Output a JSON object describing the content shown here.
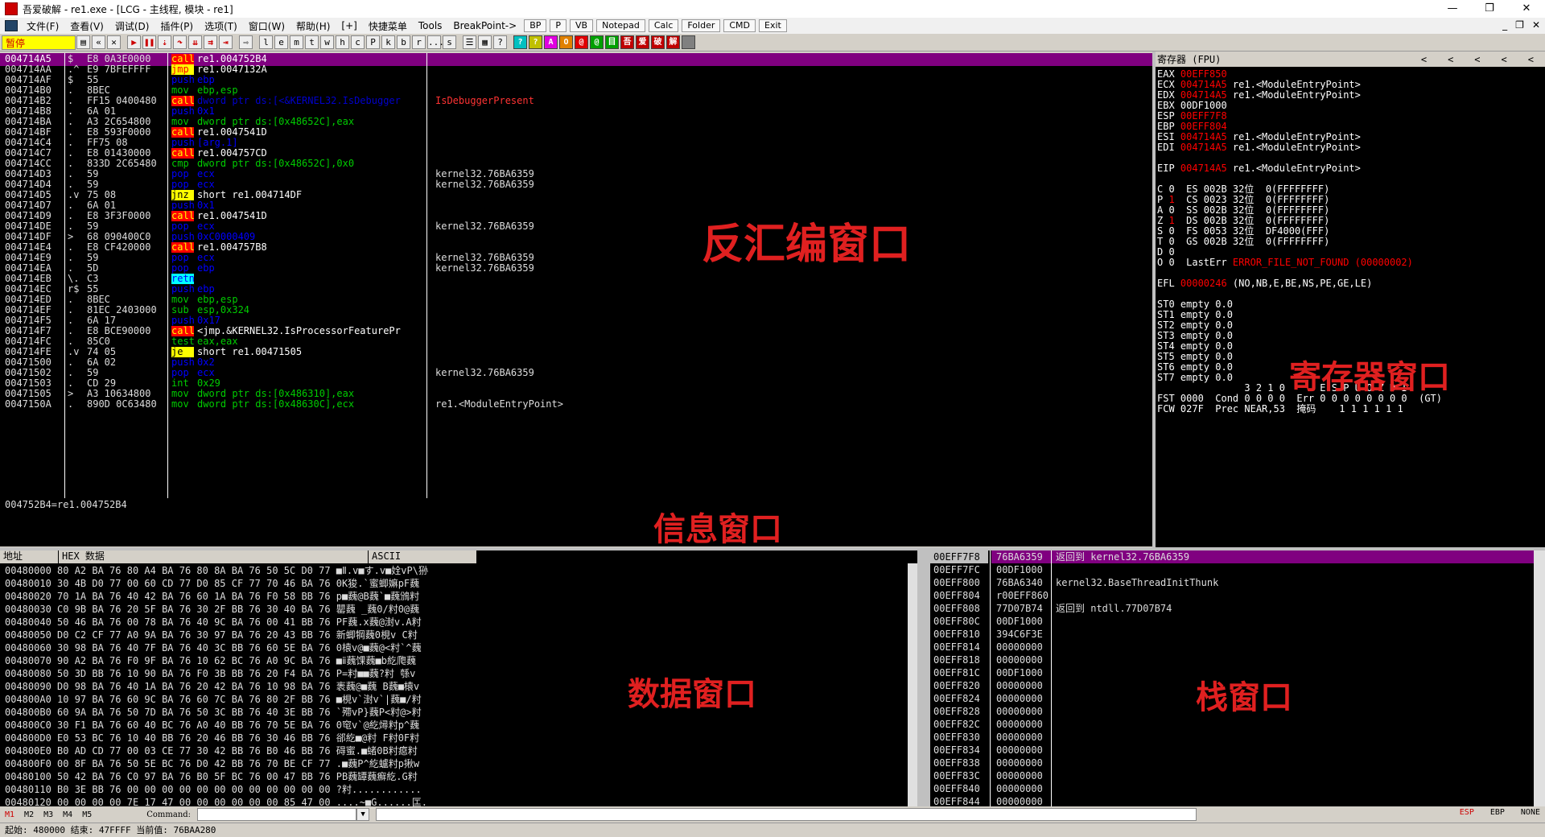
{
  "title": "吾爱破解 - re1.exe - [LCG - 主线程, 模块 - re1]",
  "menu": [
    "文件(F)",
    "查看(V)",
    "调试(D)",
    "插件(P)",
    "选项(T)",
    "窗口(W)",
    "帮助(H)",
    "[+]",
    "快捷菜单",
    "Tools",
    "BreakPoint->"
  ],
  "quick_buttons": [
    "BP",
    "P",
    "VB",
    "Notepad",
    "Calc",
    "Folder",
    "CMD",
    "Exit"
  ],
  "status_paused": "暂停",
  "toolbar_letters": [
    "l",
    "e",
    "m",
    "t",
    "w",
    "h",
    "c",
    "P",
    "k",
    "b",
    "r",
    "...",
    "s"
  ],
  "color_buttons": [
    {
      "label": "?",
      "color": "#00c0c0"
    },
    {
      "label": "?",
      "color": "#c0c000"
    },
    {
      "label": "A",
      "color": "#e000e0"
    },
    {
      "label": "O",
      "color": "#e08000"
    },
    {
      "label": "@",
      "color": "#e00000"
    },
    {
      "label": "@",
      "color": "#00a000"
    },
    {
      "label": "目",
      "color": "#00a000"
    },
    {
      "label": "吾",
      "color": "#c00000"
    },
    {
      "label": "爱",
      "color": "#c00000"
    },
    {
      "label": "破",
      "color": "#c00000"
    },
    {
      "label": "解",
      "color": "#c00000"
    },
    {
      "label": "",
      "color": "#808080"
    }
  ],
  "disasm": {
    "rows": [
      {
        "addr": "004714A5",
        "flag": "$",
        "hex": "E8 0A3E0000",
        "mnem": "call",
        "oper": "re1.004752B4",
        "cmt": "",
        "mtype": "call",
        "sel": true
      },
      {
        "addr": "004714AA",
        "flag": ".^",
        "hex": "E9 7BFEFFFF",
        "mnem": "jmp",
        "oper": "re1.0047132A",
        "cmt": "",
        "mtype": "jmp"
      },
      {
        "addr": "004714AF",
        "flag": "$",
        "hex": "55",
        "mnem": "push",
        "oper": "ebp",
        "cmt": "",
        "mtype": "push"
      },
      {
        "addr": "004714B0",
        "flag": ".",
        "hex": "8BEC",
        "mnem": "mov",
        "oper": "ebp,esp",
        "cmt": "",
        "mtype": "mov"
      },
      {
        "addr": "004714B2",
        "flag": ".",
        "hex": "FF15 0400480",
        "mnem": "call",
        "oper": "dword ptr ds:[<&KERNEL32.IsDebugger",
        "cmt": "IsDebuggerPresent",
        "mtype": "call",
        "cmtred": true
      },
      {
        "addr": "004714B8",
        "flag": ".",
        "hex": "6A 01",
        "mnem": "push",
        "oper": "0x1",
        "cmt": "",
        "mtype": "push"
      },
      {
        "addr": "004714BA",
        "flag": ".",
        "hex": "A3 2C654800",
        "mnem": "mov",
        "oper": "dword ptr ds:[0x48652C],eax",
        "cmt": "",
        "mtype": "mov"
      },
      {
        "addr": "004714BF",
        "flag": ".",
        "hex": "E8 593F0000",
        "mnem": "call",
        "oper": "re1.0047541D",
        "cmt": "",
        "mtype": "call"
      },
      {
        "addr": "004714C4",
        "flag": ".",
        "hex": "FF75 08",
        "mnem": "push",
        "oper": "[arg.1]",
        "cmt": "",
        "mtype": "push"
      },
      {
        "addr": "004714C7",
        "flag": ".",
        "hex": "E8 01430000",
        "mnem": "call",
        "oper": "re1.004757CD",
        "cmt": "",
        "mtype": "call"
      },
      {
        "addr": "004714CC",
        "flag": ".",
        "hex": "833D 2C65480",
        "mnem": "cmp",
        "oper": "dword ptr ds:[0x48652C],0x0",
        "cmt": "",
        "mtype": "cmp"
      },
      {
        "addr": "004714D3",
        "flag": ".",
        "hex": "59",
        "mnem": "pop",
        "oper": "ecx",
        "cmt": "kernel32.76BA6359",
        "mtype": "pop"
      },
      {
        "addr": "004714D4",
        "flag": ".",
        "hex": "59",
        "mnem": "pop",
        "oper": "ecx",
        "cmt": "kernel32.76BA6359",
        "mtype": "pop"
      },
      {
        "addr": "004714D5",
        "flag": ".v",
        "hex": "75 08",
        "mnem": "jnz",
        "oper": "short re1.004714DF",
        "cmt": "",
        "mtype": "jnz"
      },
      {
        "addr": "004714D7",
        "flag": ".",
        "hex": "6A 01",
        "mnem": "push",
        "oper": "0x1",
        "cmt": "",
        "mtype": "push"
      },
      {
        "addr": "004714D9",
        "flag": ".",
        "hex": "E8 3F3F0000",
        "mnem": "call",
        "oper": "re1.0047541D",
        "cmt": "",
        "mtype": "call"
      },
      {
        "addr": "004714DE",
        "flag": ".",
        "hex": "59",
        "mnem": "pop",
        "oper": "ecx",
        "cmt": "kernel32.76BA6359",
        "mtype": "pop"
      },
      {
        "addr": "004714DF",
        "flag": ">",
        "hex": "68 090400C0",
        "mnem": "push",
        "oper": "0xC0000409",
        "cmt": "",
        "mtype": "push"
      },
      {
        "addr": "004714E4",
        "flag": ".",
        "hex": "E8 CF420000",
        "mnem": "call",
        "oper": "re1.004757B8",
        "cmt": "",
        "mtype": "call"
      },
      {
        "addr": "004714E9",
        "flag": ".",
        "hex": "59",
        "mnem": "pop",
        "oper": "ecx",
        "cmt": "kernel32.76BA6359",
        "mtype": "pop"
      },
      {
        "addr": "004714EA",
        "flag": ".",
        "hex": "5D",
        "mnem": "pop",
        "oper": "ebp",
        "cmt": "kernel32.76BA6359",
        "mtype": "pop"
      },
      {
        "addr": "004714EB",
        "flag": "\\.",
        "hex": "C3",
        "mnem": "retn",
        "oper": "",
        "cmt": "",
        "mtype": "retn"
      },
      {
        "addr": "004714EC",
        "flag": "r$",
        "hex": "55",
        "mnem": "push",
        "oper": "ebp",
        "cmt": "",
        "mtype": "push"
      },
      {
        "addr": "004714ED",
        "flag": ".",
        "hex": "8BEC",
        "mnem": "mov",
        "oper": "ebp,esp",
        "cmt": "",
        "mtype": "mov"
      },
      {
        "addr": "004714EF",
        "flag": ".",
        "hex": "81EC 2403000",
        "mnem": "sub",
        "oper": "esp,0x324",
        "cmt": "",
        "mtype": "sub"
      },
      {
        "addr": "004714F5",
        "flag": ".",
        "hex": "6A 17",
        "mnem": "push",
        "oper": "0x17",
        "cmt": "",
        "mtype": "push"
      },
      {
        "addr": "004714F7",
        "flag": ".",
        "hex": "E8 BCE90000",
        "mnem": "call",
        "oper": "<jmp.&KERNEL32.IsProcessorFeaturePr",
        "cmt": "",
        "mtype": "call"
      },
      {
        "addr": "004714FC",
        "flag": ".",
        "hex": "85C0",
        "mnem": "test",
        "oper": "eax,eax",
        "cmt": "",
        "mtype": "test"
      },
      {
        "addr": "004714FE",
        "flag": ".v",
        "hex": "74 05",
        "mnem": "je",
        "oper": "short re1.00471505",
        "cmt": "",
        "mtype": "je"
      },
      {
        "addr": "00471500",
        "flag": ".",
        "hex": "6A 02",
        "mnem": "push",
        "oper": "0x2",
        "cmt": "",
        "mtype": "push"
      },
      {
        "addr": "00471502",
        "flag": ".",
        "hex": "59",
        "mnem": "pop",
        "oper": "ecx",
        "cmt": "kernel32.76BA6359",
        "mtype": "pop"
      },
      {
        "addr": "00471503",
        "flag": ".",
        "hex": "CD 29",
        "mnem": "int",
        "oper": "0x29",
        "cmt": "",
        "mtype": "int"
      },
      {
        "addr": "00471505",
        "flag": ">",
        "hex": "A3 10634800",
        "mnem": "mov",
        "oper": "dword ptr ds:[0x486310],eax",
        "cmt": "",
        "mtype": "mov"
      },
      {
        "addr": "0047150A",
        "flag": ".",
        "hex": "890D 0C63480",
        "mnem": "mov",
        "oper": "dword ptr ds:[0x48630C],ecx",
        "cmt": "re1.<ModuleEntryPoint>",
        "mtype": "mov"
      }
    ],
    "annotation": "反汇编窗口"
  },
  "info": {
    "text": "004752B4=re1.004752B4",
    "annotation": "信息窗口"
  },
  "registers": {
    "header": "寄存器 (FPU)",
    "arrows": [
      "<",
      "<",
      "<",
      "<",
      "<"
    ],
    "lines": [
      {
        "t": "EAX ",
        "v": "00EFF850",
        "c": ""
      },
      {
        "t": "ECX ",
        "v": "004714A5",
        "c": " re1.<ModuleEntryPoint>"
      },
      {
        "t": "EDX ",
        "v": "004714A5",
        "c": " re1.<ModuleEntryPoint>"
      },
      {
        "t": "EBX 00DF1000",
        "v": "",
        "c": ""
      },
      {
        "t": "ESP ",
        "v": "00EFF7F8",
        "c": ""
      },
      {
        "t": "EBP ",
        "v": "00EFF804",
        "c": ""
      },
      {
        "t": "ESI ",
        "v": "004714A5",
        "c": " re1.<ModuleEntryPoint>"
      },
      {
        "t": "EDI ",
        "v": "004714A5",
        "c": " re1.<ModuleEntryPoint>"
      },
      {
        "t": "",
        "v": "",
        "c": ""
      },
      {
        "t": "EIP ",
        "v": "004714A5",
        "c": " re1.<ModuleEntryPoint>"
      },
      {
        "t": "",
        "v": "",
        "c": ""
      },
      {
        "t": "C 0  ES 002B 32位  0(FFFFFFFF)",
        "v": "",
        "c": ""
      },
      {
        "t": "P ",
        "v": "1",
        "c": "  CS 0023 32位  0(FFFFFFFF)"
      },
      {
        "t": "A 0  SS 002B 32位  0(FFFFFFFF)",
        "v": "",
        "c": ""
      },
      {
        "t": "Z ",
        "v": "1",
        "c": "  DS 002B 32位  0(FFFFFFFF)"
      },
      {
        "t": "S 0  FS 0053 32位  DF4000(FFF)",
        "v": "",
        "c": ""
      },
      {
        "t": "T 0  GS 002B 32位  0(FFFFFFFF)",
        "v": "",
        "c": ""
      },
      {
        "t": "D 0",
        "v": "",
        "c": ""
      },
      {
        "t": "O 0  LastErr ",
        "v": "ERROR_FILE_NOT_FOUND (00000002)",
        "c": ""
      },
      {
        "t": "",
        "v": "",
        "c": ""
      },
      {
        "t": "EFL ",
        "v": "00000246",
        "c": " (NO,NB,E,BE,NS,PE,GE,LE)"
      },
      {
        "t": "",
        "v": "",
        "c": ""
      },
      {
        "t": "ST0 empty 0.0",
        "v": "",
        "c": ""
      },
      {
        "t": "ST1 empty 0.0",
        "v": "",
        "c": ""
      },
      {
        "t": "ST2 empty 0.0",
        "v": "",
        "c": ""
      },
      {
        "t": "ST3 empty 0.0",
        "v": "",
        "c": ""
      },
      {
        "t": "ST4 empty 0.0",
        "v": "",
        "c": ""
      },
      {
        "t": "ST5 empty 0.0",
        "v": "",
        "c": ""
      },
      {
        "t": "ST6 empty 0.0",
        "v": "",
        "c": ""
      },
      {
        "t": "ST7 empty 0.0",
        "v": "",
        "c": ""
      },
      {
        "t": "               3 2 1 0      E S P U O Z D I",
        "v": "",
        "c": ""
      },
      {
        "t": "FST 0000  Cond 0 0 0 0  Err 0 0 0 0 0 0 0 0  (GT)",
        "v": "",
        "c": ""
      },
      {
        "t": "FCW 027F  Prec NEAR,53  掩码    1 1 1 1 1 1",
        "v": "",
        "c": ""
      }
    ],
    "annotation": "寄存器窗口"
  },
  "dump": {
    "headers": [
      "地址",
      "HEX 数据",
      "ASCII"
    ],
    "rows": [
      "00480000 80 A2 BA 76 80 A4 BA 76 80 8A BA 76 50 5C D0 77 ■Ⅱ.v■す.v■姾vP\\狲",
      "00480010 30 4B D0 77 00 60 CD 77 D0 85 CF 77 70 46 BA 76 0K狻.`蜜蝍嫲pF蘶",
      "00480020 70 1A BA 76 40 42 BA 76 60 1A BA 76 F0 58 BB 76 p■蘶@B蘶`■蘶鳻籿",
      "00480030 C0 9B BA 76 20 5F BA 76 30 2F BB 76 30 40 BA 76 罌蘶 _蘶0/籿0@蘶",
      "00480040 50 46 BA 76 00 78 BA 76 40 9C BA 76 00 41 BB 76 PF蘶.x蘶@湗v.A籿",
      "00480050 D0 C2 CF 77 A0 9A BA 76 30 97 BA 76 20 43 BB 76 新蝍犅蘶0梘v C籿",
      "00480060 30 98 BA 76 40 7F BA 76 40 3C BB 76 60 5E BA 76 0榬v@■蘶@<籿`^蘶",
      "00480070 90 A2 BA 76 F0 9F BA 76 10 62 BC 76 A0 9C BA 76 ■ⅱ蘶馃蘶■b紇爮蘶",
      "00480080 50 3D BB 76 10 90 BA 76 F0 3B BB 76 20 F4 BA 76 P=籿■■蘶?籿 綔v",
      "00480090 D0 98 BA 76 40 1A BA 76 20 42 BA 76 10 98 BA 76 袠蘶@■蘶 B蘶■榬v",
      "004800A0 10 97 BA 76 60 9C BA 76 60 7C BA 76 80 2F BB 76 ■梘v`湗v`|蘶■/籿",
      "004800B0 60 9A BA 76 50 7D BA 76 50 3C BB 76 40 3E BB 76 `殢vP}蘶P<籿@>籿",
      "004800C0 30 F1 BA 76 60 40 BC 76 A0 40 BB 76 70 5E BA 76 0窀v`@紇燖籿p^蘶",
      "004800D0 E0 53 BC 76 10 40 BB 76 20 46 BB 76 30 46 BB 76 郤紇■@籿 F籿0F籿",
      "004800E0 B0 AD CD 77 00 03 CE 77 30 42 BB 76 B0 46 BB 76 碍蜜.■蝫0B籿癋籿",
      "004800F0 00 8F BA 76 50 5E BC 76 D0 42 BB 76 70 BE CF 77 .■蘶P^紇蠦籿p揪w",
      "00480100 50 42 BA 76 C0 97 BA 76 B0 5F BC 76 00 47 BB 76 PB蘶罈蘶癬紇.G籿",
      "00480110 B0 3E BB 76 00 00 00 00 00 00 00 00 00 00 00 00 ?籿............",
      "00480120 00 00 00 00 7E 17 47 00 00 00 00 00 00 85 47 00 ....~■G......匞."
    ],
    "annotation": "数据窗口"
  },
  "stack": {
    "rows": [
      {
        "a": "00EFF7F8",
        "v": "76BA6359",
        "c": "返回到 kernel32.76BA6359",
        "sel": true
      },
      {
        "a": "00EFF7FC",
        "v": "00DF1000",
        "c": ""
      },
      {
        "a": "00EFF800",
        "v": "76BA6340",
        "c": "kernel32.BaseThreadInitThunk"
      },
      {
        "a": "00EFF804",
        "v": "r00EFF860",
        "c": ""
      },
      {
        "a": "00EFF808",
        "v": "77D07B74",
        "c": "返回到 ntdll.77D07B74"
      },
      {
        "a": "00EFF80C",
        "v": "00DF1000",
        "c": ""
      },
      {
        "a": "00EFF810",
        "v": "394C6F3E",
        "c": ""
      },
      {
        "a": "00EFF814",
        "v": "00000000",
        "c": ""
      },
      {
        "a": "00EFF818",
        "v": "00000000",
        "c": ""
      },
      {
        "a": "00EFF81C",
        "v": "00DF1000",
        "c": ""
      },
      {
        "a": "00EFF820",
        "v": "00000000",
        "c": ""
      },
      {
        "a": "00EFF824",
        "v": "00000000",
        "c": ""
      },
      {
        "a": "00EFF828",
        "v": "00000000",
        "c": ""
      },
      {
        "a": "00EFF82C",
        "v": "00000000",
        "c": ""
      },
      {
        "a": "00EFF830",
        "v": "00000000",
        "c": ""
      },
      {
        "a": "00EFF834",
        "v": "00000000",
        "c": ""
      },
      {
        "a": "00EFF838",
        "v": "00000000",
        "c": ""
      },
      {
        "a": "00EFF83C",
        "v": "00000000",
        "c": ""
      },
      {
        "a": "00EFF840",
        "v": "00000000",
        "c": ""
      },
      {
        "a": "00EFF844",
        "v": "00000000",
        "c": ""
      }
    ],
    "annotation": "栈窗口"
  },
  "cmdbar": {
    "tabs": [
      "M1",
      "M2",
      "M3",
      "M4",
      "M5"
    ],
    "label": "Command:",
    "right": [
      "ESP",
      "EBP",
      "NONE"
    ]
  },
  "statusbar": "起始: 480000 结束: 47FFFF 当前值: 76BAA280"
}
